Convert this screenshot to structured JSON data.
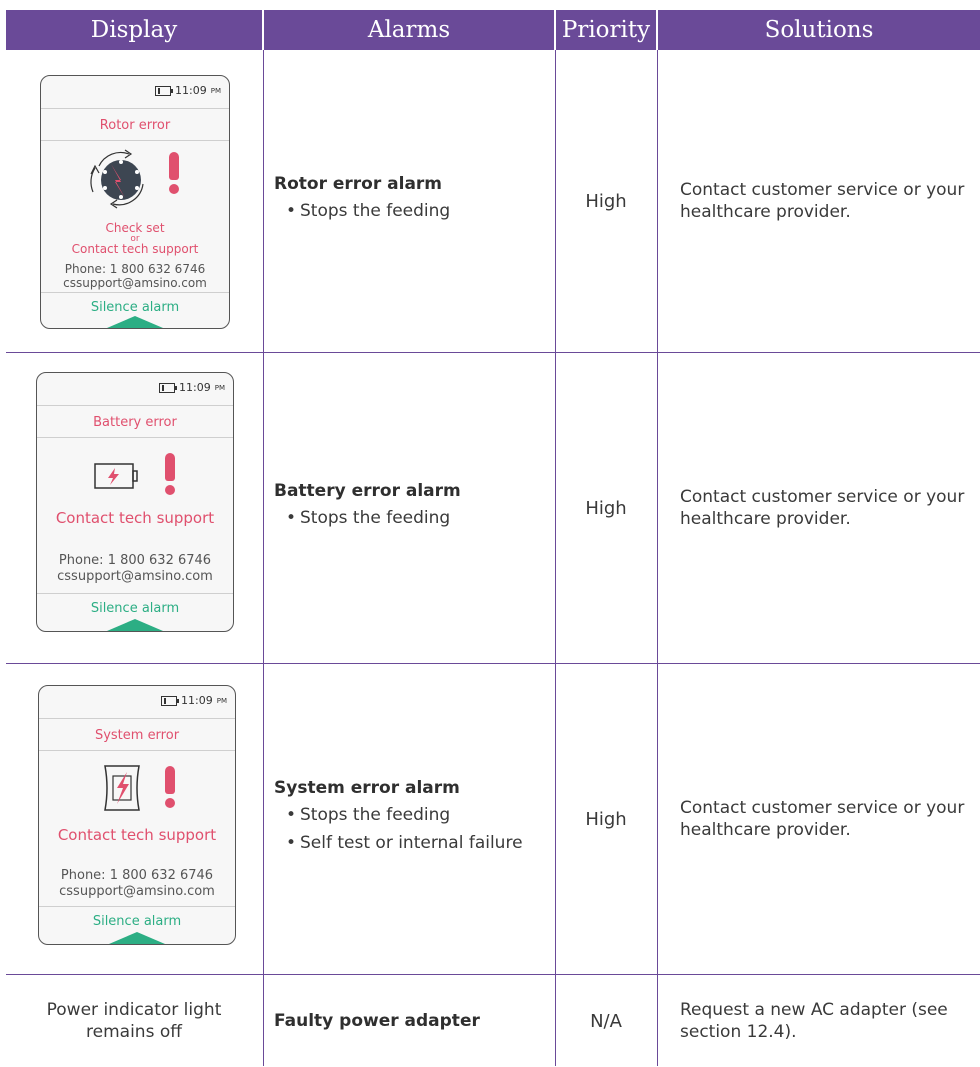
{
  "columns": [
    "Display",
    "Alarms",
    "Priority",
    "Solutions"
  ],
  "devices": {
    "time": "11:09",
    "ampm": "PM",
    "phone": "Phone: 1 800 632 6746",
    "email": "cssupport@amsino.com",
    "silence": "Silence alarm"
  },
  "rows": [
    {
      "screen_title": "Rotor error",
      "screen_msg_1": "Check set",
      "screen_msg_or": "or",
      "screen_msg_2": "Contact tech support",
      "alarm": "Rotor error alarm",
      "bullets": [
        "Stops the feeding"
      ],
      "priority": "High",
      "solution": "Contact customer service or your healthcare provider."
    },
    {
      "screen_title": "Battery error",
      "screen_msg": "Contact tech support",
      "alarm": "Battery error alarm",
      "bullets": [
        "Stops the feeding"
      ],
      "priority": "High",
      "solution": "Contact customer service or your healthcare provider."
    },
    {
      "screen_title": "System error",
      "screen_msg": "Contact tech support",
      "alarm": "System error alarm",
      "bullets": [
        "Stops the feeding",
        "Self test or internal failure"
      ],
      "priority": "High",
      "solution": "Contact customer service or your healthcare provider."
    },
    {
      "display": "Power indicator light remains off",
      "alarm": "Faulty power adapter",
      "priority": "N/A",
      "solution": "Request a new AC adapter (see section 12.4)."
    }
  ],
  "colors": {
    "header": "#6a4a98",
    "alert": "#e0506e",
    "silence": "#2cae84"
  }
}
